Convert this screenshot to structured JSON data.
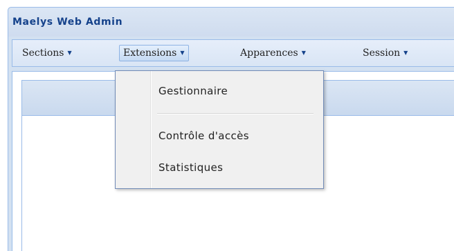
{
  "window": {
    "title": "Maelys Web Admin"
  },
  "menubar": {
    "items": [
      {
        "label": "Sections",
        "arrow": "▼"
      },
      {
        "label": "Extensions",
        "arrow": "▼"
      },
      {
        "label": "Apparences",
        "arrow": "▼"
      },
      {
        "label": "Session",
        "arrow": "▼"
      }
    ]
  },
  "dropdown": {
    "items": [
      {
        "label": "Gestionnaire"
      },
      {
        "label": "Contrôle d'accès"
      },
      {
        "label": "Statistiques"
      }
    ]
  },
  "colors": {
    "title_text": "#15428b",
    "panel_border": "#99bbe8",
    "panel_bg": "#d3e1f1"
  }
}
